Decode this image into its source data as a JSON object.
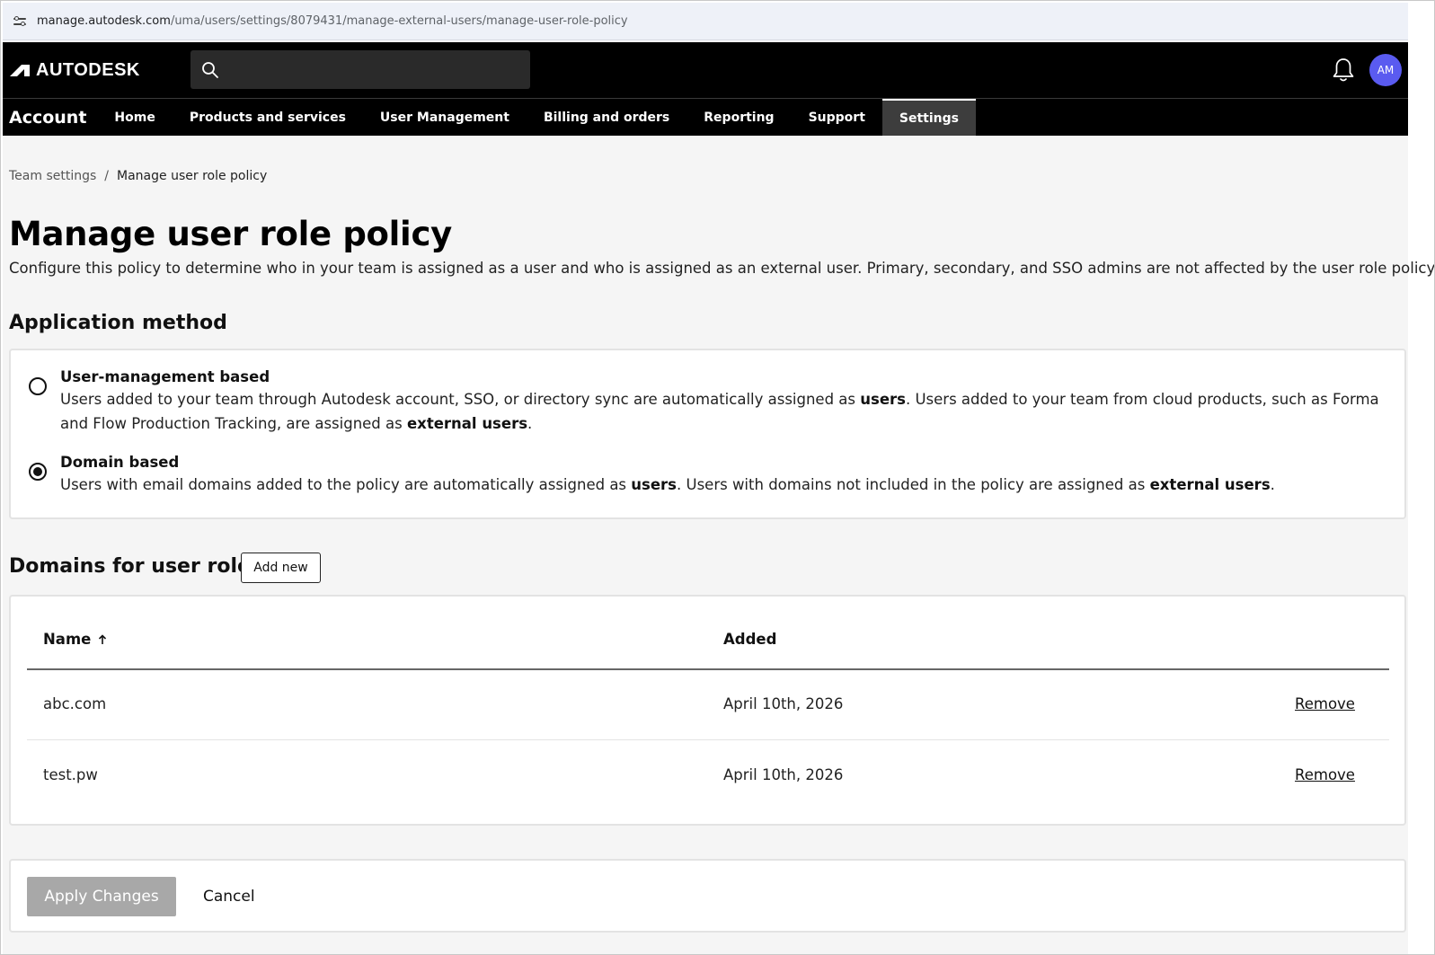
{
  "browser": {
    "url_host": "manage.autodesk.com",
    "url_path": "/uma/users/settings/8079431/manage-external-users/manage-user-role-policy",
    "site_info_icon": "tune-icon"
  },
  "header": {
    "logo_text": "AUTODESK",
    "search_icon": "search-icon",
    "bell_icon": "bell-icon",
    "avatar_initials": "AM",
    "avatar_color": "#5a5bf0"
  },
  "nav": {
    "account_label": "Account",
    "items": [
      {
        "label": "Home"
      },
      {
        "label": "Products and services"
      },
      {
        "label": "User Management"
      },
      {
        "label": "Billing and orders"
      },
      {
        "label": "Reporting"
      },
      {
        "label": "Support"
      },
      {
        "label": "Settings",
        "active": true
      }
    ]
  },
  "breadcrumb": {
    "parent": "Team settings",
    "separator": "/",
    "current": "Manage user role policy"
  },
  "page": {
    "title": "Manage user role policy",
    "description": "Configure this policy to determine who in your team is assigned as a user and who is assigned as an external user. Primary, secondary, and SSO admins are not affected by the user role policy."
  },
  "application_method": {
    "title": "Application method",
    "options": [
      {
        "label": "User-management based",
        "selected": false,
        "desc_parts": [
          "Users added to your team through Autodesk account, SSO, or directory sync are automatically assigned as ",
          "users",
          ". Users added to your team from cloud products, such as Forma and Flow Production Tracking, are assigned as ",
          "external users",
          "."
        ]
      },
      {
        "label": "Domain based",
        "selected": true,
        "desc_parts": [
          "Users with email domains added to the policy are automatically assigned as ",
          "users",
          ". Users with domains not included in the policy are assigned as ",
          "external users",
          "."
        ]
      }
    ]
  },
  "domains": {
    "title": "Domains for user role",
    "add_new_label": "Add new",
    "columns": {
      "name": "Name",
      "added": "Added"
    },
    "sort_icon": "arrow-up-icon",
    "rows": [
      {
        "name": "abc.com",
        "added": "April 10th, 2026",
        "action": "Remove"
      },
      {
        "name": "test.pw",
        "added": "April 10th, 2026",
        "action": "Remove"
      }
    ]
  },
  "actions": {
    "apply_label": "Apply Changes",
    "cancel_label": "Cancel"
  },
  "colors": {
    "header_bg": "#000000",
    "content_bg": "#f5f5f5",
    "apply_disabled_bg": "#a8a8a8"
  }
}
